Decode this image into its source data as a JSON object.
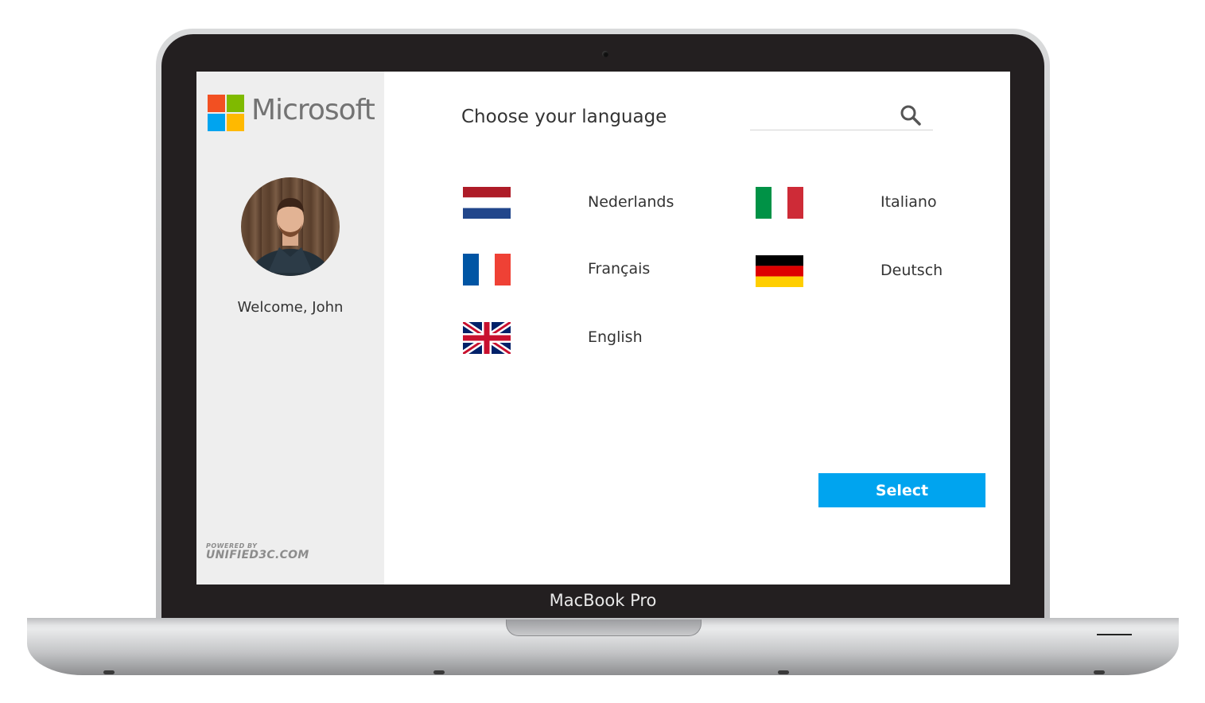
{
  "device": {
    "label": "MacBook Pro"
  },
  "sidebar": {
    "brand": "Microsoft",
    "welcome": "Welcome, John",
    "powered_by_small": "POWERED BY",
    "powered_by_big": "UNIFIED3C.COM"
  },
  "main": {
    "title": "Choose your language",
    "search": {
      "value": "",
      "placeholder": "",
      "icon": "search-icon"
    },
    "languages": [
      {
        "label": "Nederlands",
        "flag": "flag-netherlands"
      },
      {
        "label": "Italiano",
        "flag": "flag-italy"
      },
      {
        "label": "Français",
        "flag": "flag-france"
      },
      {
        "label": "Deutsch",
        "flag": "flag-germany"
      },
      {
        "label": "English",
        "flag": "flag-united-kingdom"
      }
    ],
    "select_label": "Select"
  },
  "colors": {
    "accent": "#00a4ef",
    "sidebar_bg": "#eeeeee",
    "ms_red": "#f25022",
    "ms_green": "#7fba00",
    "ms_blue": "#00a4ef",
    "ms_yellow": "#ffb900"
  }
}
